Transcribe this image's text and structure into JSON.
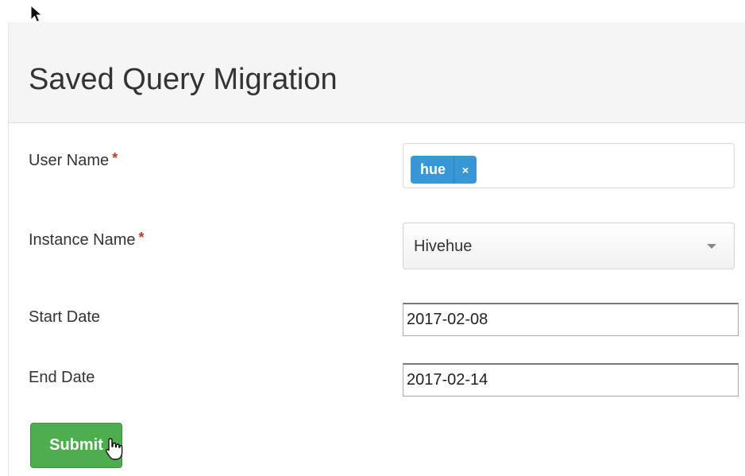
{
  "form": {
    "title": "Saved Query Migration",
    "user_name": {
      "label": "User Name",
      "required_mark": "*",
      "tags": [
        {
          "label": "hue",
          "remove_label": "×"
        }
      ]
    },
    "instance_name": {
      "label": "Instance Name",
      "required_mark": "*",
      "selected": "Hivehue"
    },
    "start_date": {
      "label": "Start Date",
      "value": "2017-02-08"
    },
    "end_date": {
      "label": "End Date",
      "value": "2017-02-14"
    },
    "submit_label": "Submit"
  },
  "colors": {
    "tag_chip": "#3a97d6",
    "submit_button": "#4cae4c",
    "required_mark": "#c0392b",
    "header_background": "#f5f5f5"
  },
  "icons": {
    "pointer_cursor": "arrow-cursor-icon",
    "hand_cursor": "hand-cursor-icon",
    "tag_remove": "close-icon",
    "select_arrow": "caret-down-icon"
  }
}
